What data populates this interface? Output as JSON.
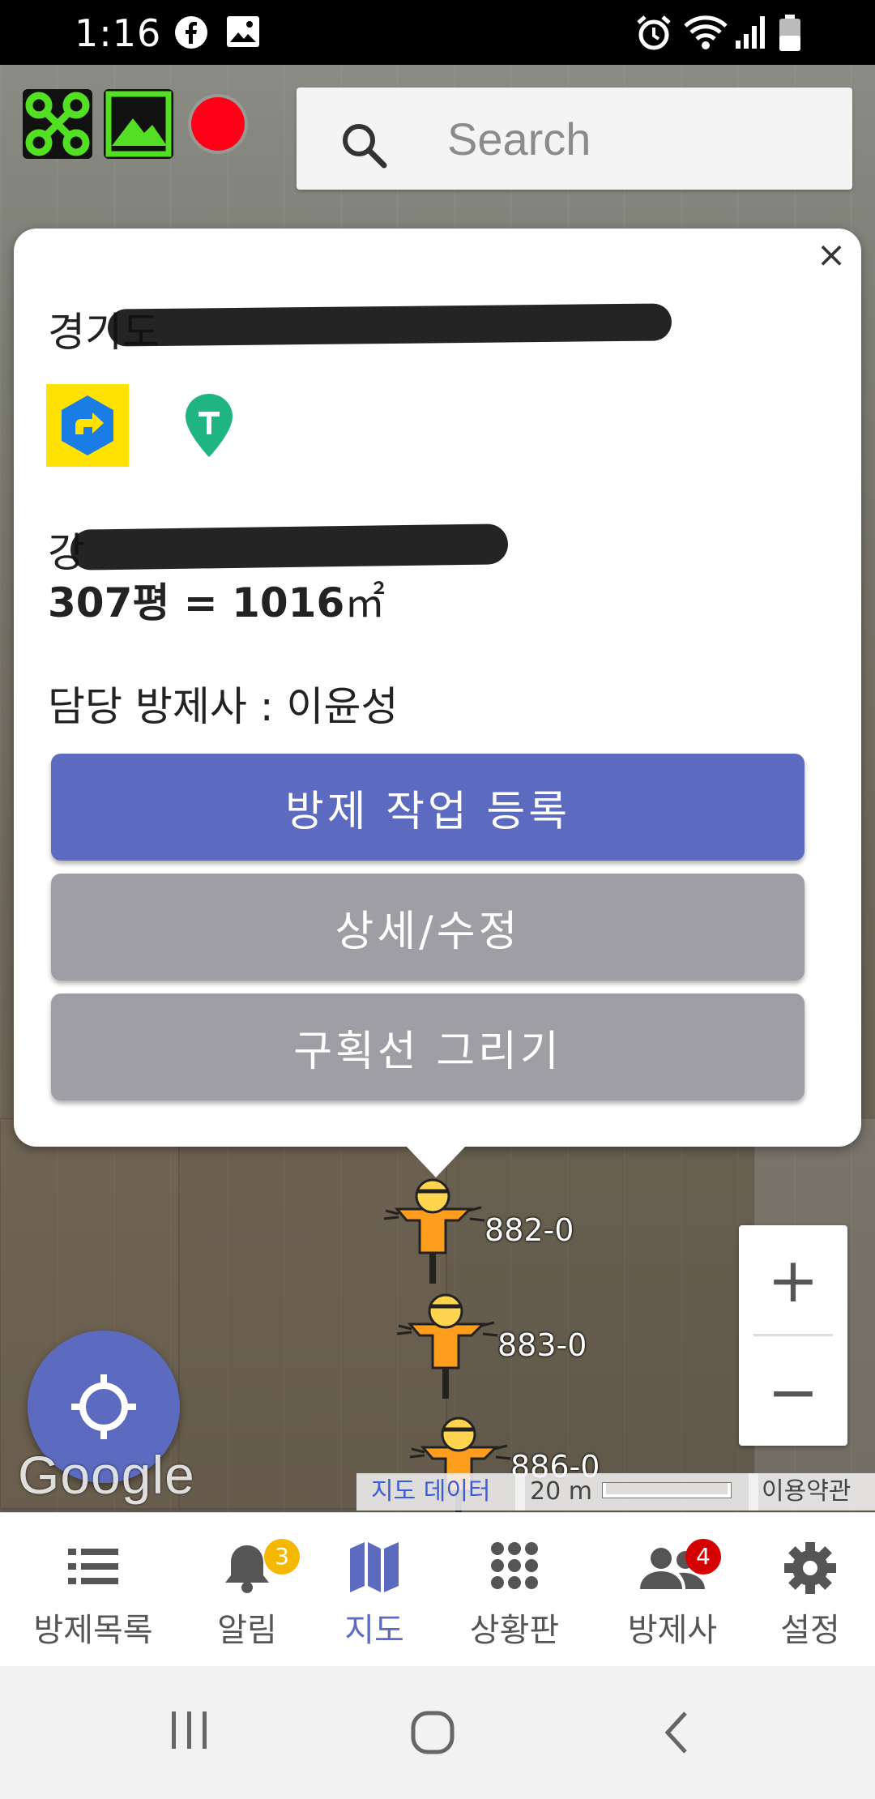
{
  "status_bar": {
    "time": "1:16"
  },
  "search": {
    "placeholder": "Search"
  },
  "popup": {
    "address": "경기도 ",
    "plot_prefix": "강",
    "area_value": "307평 = 1016",
    "area_unit": "㎡",
    "manager": "담당 방제사 : 이윤성",
    "actions": {
      "register": "방제 작업 등록",
      "detail_edit": "상세/수정",
      "draw_boundary": "구획선 그리기"
    },
    "close": "×"
  },
  "markers": [
    {
      "label": "882-0"
    },
    {
      "label": "883-0"
    },
    {
      "label": "886-0"
    }
  ],
  "map": {
    "logo": "Google",
    "map_data": "지도 데이터",
    "scale_label": "20 m",
    "terms": "이용약관",
    "zoom_in": "+",
    "zoom_out": "−"
  },
  "bottom_nav": {
    "items": [
      {
        "label": "방제목록",
        "icon": "list-icon"
      },
      {
        "label": "알림",
        "icon": "bell-icon",
        "badge": "3"
      },
      {
        "label": "지도",
        "icon": "map-icon",
        "active": true
      },
      {
        "label": "상황판",
        "icon": "grid-icon"
      },
      {
        "label": "방제사",
        "icon": "people-icon",
        "badge": "4"
      },
      {
        "label": "설정",
        "icon": "gear-icon"
      }
    ]
  },
  "colors": {
    "accent": "#5c6bc0",
    "record": "#ff0019",
    "badge_yellow": "#f5b800",
    "badge_red": "#d50000",
    "secondary_button": "#9e9ea4"
  }
}
